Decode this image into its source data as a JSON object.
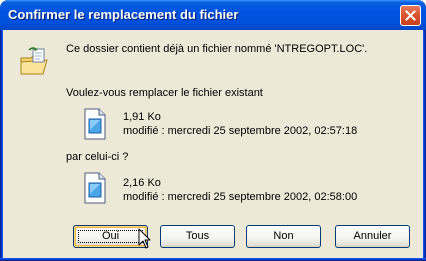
{
  "window": {
    "title": "Confirmer le remplacement du fichier"
  },
  "message": {
    "intro": "Ce dossier contient déjà un fichier nommé 'NTREGOPT.LOC'.",
    "question": "Voulez-vous remplacer le fichier existant",
    "with_label": "par celui-ci ?"
  },
  "existing_file": {
    "size": "1,91 Ko",
    "modified": "modifié : mercredi 25 septembre 2002, 02:57:18"
  },
  "new_file": {
    "size": "2,16 Ko",
    "modified": "modifié : mercredi 25 septembre 2002, 02:58:00"
  },
  "buttons": {
    "yes": "Oui",
    "all": "Tous",
    "no": "Non",
    "cancel": "Annuler"
  },
  "icons": {
    "title_close": "close-icon",
    "dialog": "folder-replace-icon",
    "file": "file-icon"
  },
  "colors": {
    "titlebar": "#0050dc",
    "client_bg": "#ece9d8",
    "close_button": "#d9522d",
    "button_border": "#003c74"
  }
}
